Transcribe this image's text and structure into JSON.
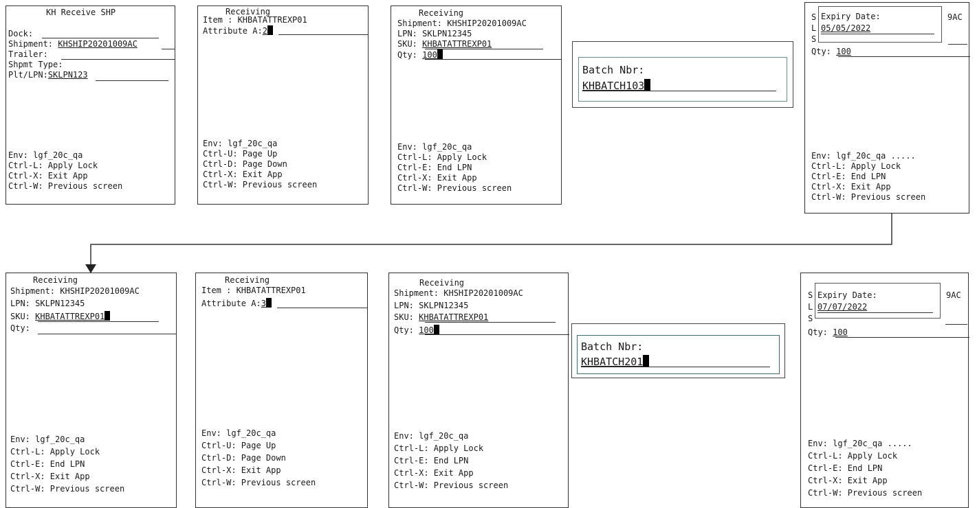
{
  "s1": {
    "title": "KH Receive SHP",
    "dock_label": "Dock:",
    "shipment_label": "Shipment:",
    "shipment_value": "KHSHIP20201009AC",
    "trailer_label": "Trailer:",
    "shpmt_type_label": "Shpmt Type:",
    "plt_lpn_label": "Plt/LPN:",
    "plt_lpn_value": "SKLPN123",
    "footer": [
      "Env: lgf_20c_qa",
      "Ctrl-L: Apply Lock",
      "Ctrl-X: Exit App",
      "Ctrl-W: Previous screen"
    ]
  },
  "s2": {
    "title": "Receiving",
    "item_line": "Item : KHBATATTREXP01",
    "attr_label": "Attribute A:",
    "attr_value": "2",
    "footer": [
      "Env: lgf_20c_qa",
      "Ctrl-U: Page Up",
      "Ctrl-D: Page Down",
      "Ctrl-X: Exit App",
      "Ctrl-W: Previous screen"
    ]
  },
  "s3": {
    "title": "Receiving",
    "shipment_line": "Shipment: KHSHIP20201009AC",
    "lpn_line": "LPN: SKLPN12345",
    "sku_label": "SKU: ",
    "sku_value": "KHBATATTREXP01",
    "qty_label": "Qty: ",
    "qty_value": "100",
    "footer": [
      "Env: lgf_20c_qa",
      "Ctrl-L: Apply Lock",
      "Ctrl-E: End LPN",
      "Ctrl-X: Exit App",
      "Ctrl-W: Previous screen"
    ]
  },
  "s4": {
    "batch_label": "Batch Nbr:",
    "batch_value": "KHBATCH103"
  },
  "s5": {
    "side_letters": [
      "S",
      "L",
      "S"
    ],
    "expiry_label": "Expiry Date:",
    "expiry_value": "05/05/2022",
    "right_text": "9AC",
    "qty_label": "Qty: ",
    "qty_value": "100",
    "footer": [
      "Env: lgf_20c_qa .....",
      "Ctrl-L: Apply Lock",
      "Ctrl-E: End LPN",
      "Ctrl-X: Exit App",
      "Ctrl-W: Previous screen"
    ]
  },
  "s6": {
    "title": "Receiving",
    "shipment_line": "Shipment: KHSHIP20201009AC",
    "lpn_line": "LPN: SKLPN12345",
    "sku_label": "SKU: ",
    "sku_value": "KHBATATTREXP01",
    "qty_label": "Qty: ",
    "footer": [
      "Env: lgf_20c_qa",
      "Ctrl-L: Apply Lock",
      "Ctrl-E: End LPN",
      "Ctrl-X: Exit App",
      "Ctrl-W: Previous screen"
    ]
  },
  "s7": {
    "title": "Receiving",
    "item_line": "Item : KHBATATTREXP01",
    "attr_label": "Attribute A:",
    "attr_value": "3",
    "footer": [
      "Env: lgf_20c_qa",
      "Ctrl-U: Page Up",
      "Ctrl-D: Page Down",
      "Ctrl-X: Exit App",
      "Ctrl-W: Previous screen"
    ]
  },
  "s8": {
    "title": "Receiving",
    "shipment_line": "Shipment: KHSHIP20201009AC",
    "lpn_line": "LPN: SKLPN12345",
    "sku_label": "SKU: ",
    "sku_value": "KHBATATTREXP01",
    "qty_label": "Qty: ",
    "qty_value": "100",
    "footer": [
      "Env: lgf_20c_qa",
      "Ctrl-L: Apply Lock",
      "Ctrl-E: End LPN",
      "Ctrl-X: Exit App",
      "Ctrl-W: Previous screen"
    ]
  },
  "s9": {
    "batch_label": "Batch Nbr:",
    "batch_value": "KHBATCH201"
  },
  "s10": {
    "side_letters": [
      "S",
      "L",
      "S"
    ],
    "expiry_label": "Expiry Date:",
    "expiry_value": "07/07/2022",
    "right_text": "9AC",
    "qty_label": "Qty: ",
    "qty_value": "100",
    "footer": [
      "Env: lgf_20c_qa .....",
      "Ctrl-L: Apply Lock",
      "Ctrl-E: End LPN",
      "Ctrl-X: Exit App",
      "Ctrl-W: Previous screen"
    ]
  },
  "connector": {
    "color": "#333333",
    "icon": "arrow-down-icon"
  }
}
